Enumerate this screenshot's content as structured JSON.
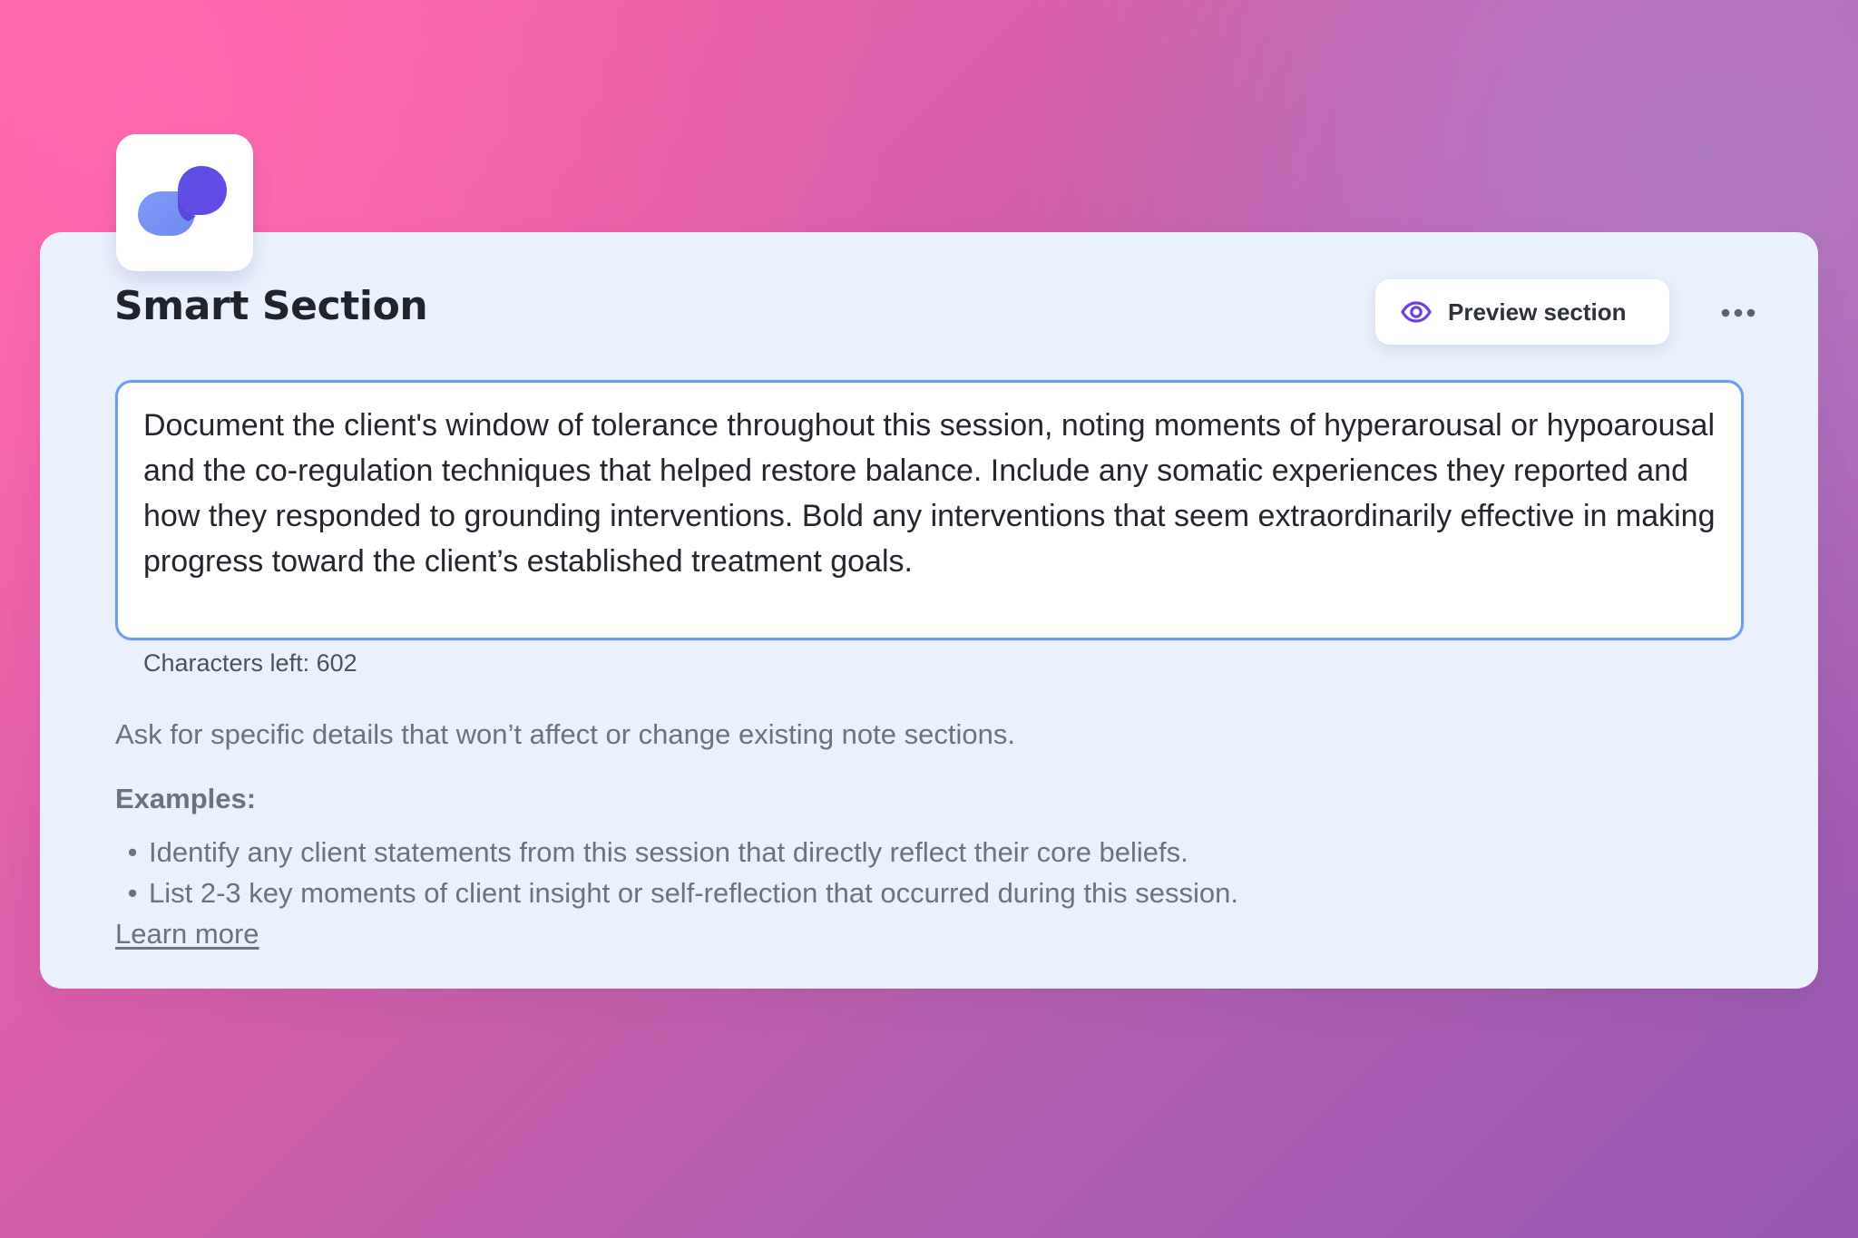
{
  "app": {
    "icon": "app-logo-icon"
  },
  "card": {
    "title": "Smart Section",
    "preview_label": "Preview section",
    "preview_icon": "eye-icon",
    "more_icon": "more-horizontal-icon",
    "prompt_text": "Document the client's window of tolerance throughout this session, noting moments of hyperarousal or hypoarousal and the co-regulation techniques that helped restore balance. Include any somatic experiences they reported and how they responded to grounding interventions. Bold any interventions that seem extraordinarily effective in making progress toward the client’s established treatment goals.",
    "characters_left_text": "Characters left: 602",
    "help_text": "Ask for specific details that won’t affect or change existing note sections.",
    "examples_heading": "Examples:",
    "examples": [
      "Identify any client statements from this session that directly reflect their core beliefs.",
      "List 2-3 key moments of client insight or self-reflection that occurred during this session."
    ],
    "learn_more": "Learn more"
  },
  "colors": {
    "background_start": "#f866aa",
    "background_end": "#9558b1",
    "card_background": "#eaf1fd",
    "input_border": "#6f9cf0",
    "preview_icon": "#6c42d9"
  }
}
